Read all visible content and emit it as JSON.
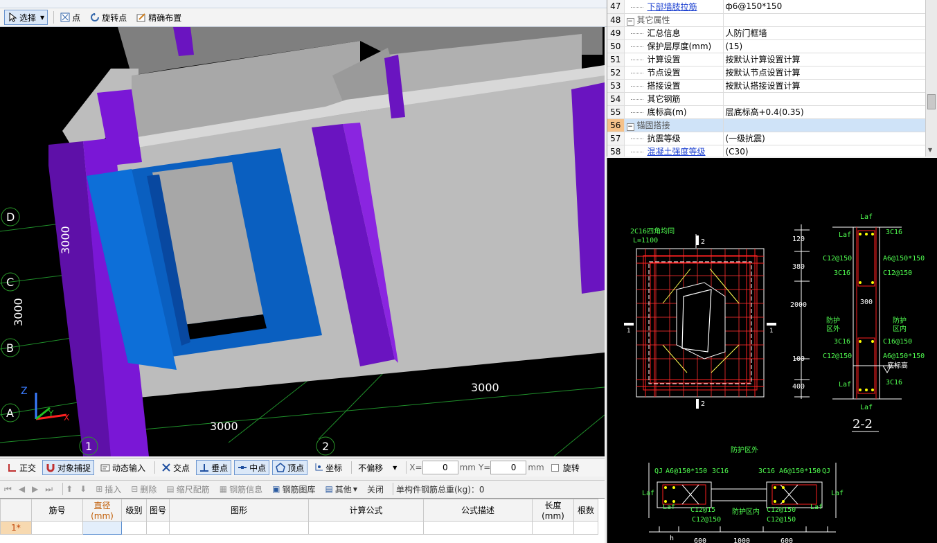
{
  "toolbar": {
    "select_label": "选择",
    "point_label": "点",
    "rotate_point_label": "旋转点",
    "precise_layout_label": "精确布置"
  },
  "viewport": {
    "axis_labels_rows": [
      "D",
      "C",
      "B",
      "A"
    ],
    "axis_labels_cols": [
      "1",
      "2"
    ],
    "dim_3000_a": "3000",
    "dim_3000_b": "3000",
    "dim_3000_c": "3000",
    "dim_3000_d": "3000",
    "axis_z": "Z",
    "axis_y": "Y",
    "axis_x": "X"
  },
  "snapbar": {
    "ortho": "正交",
    "object_snap": "对象捕捉",
    "dynamic_input": "动态输入",
    "intersection": "交点",
    "perpendicular": "垂点",
    "midpoint": "中点",
    "vertex": "顶点",
    "coordinate": "坐标",
    "offset_mode": "不偏移",
    "x_label": "X=",
    "x_value": "0",
    "y_label": "Y=",
    "y_value": "0",
    "unit_mm_1": "mm",
    "unit_mm_2": "mm",
    "rotate_label": "旋转"
  },
  "rebarbar": {
    "insert": "插入",
    "delete": "删除",
    "scale_rebar": "缩尺配筋",
    "rebar_info": "钢筋信息",
    "rebar_library": "钢筋图库",
    "other": "其他",
    "close": "关闭",
    "total_weight": "单构件钢筋总重(kg)：0"
  },
  "grid": {
    "headers": [
      "筋号",
      "直径(mm)",
      "级别",
      "图号",
      "图形",
      "计算公式",
      "公式描述",
      "长度(mm)",
      "根数"
    ],
    "row1_index": "1*"
  },
  "props": {
    "rows": [
      {
        "n": "47",
        "name": "下部墙肢拉筋",
        "value": "ф6@150*150",
        "link": true
      },
      {
        "n": "48",
        "name": "其它属性",
        "value": "",
        "group": true
      },
      {
        "n": "49",
        "name": "汇总信息",
        "value": "人防门框墙"
      },
      {
        "n": "50",
        "name": "保护层厚度(mm)",
        "value": "(15)"
      },
      {
        "n": "51",
        "name": "计算设置",
        "value": "按默认计算设置计算"
      },
      {
        "n": "52",
        "name": "节点设置",
        "value": "按默认节点设置计算"
      },
      {
        "n": "53",
        "name": "搭接设置",
        "value": "按默认搭接设置计算"
      },
      {
        "n": "54",
        "name": "其它钢筋",
        "value": ""
      },
      {
        "n": "55",
        "name": "底标高(m)",
        "value": "层底标高+0.4(0.35)"
      },
      {
        "n": "56",
        "name": "锚固搭接",
        "value": "",
        "group": true,
        "selected": true
      },
      {
        "n": "57",
        "name": "抗震等级",
        "value": "(一级抗震)"
      },
      {
        "n": "58",
        "name": "混凝土强度等级",
        "value": "(C30)",
        "link": true
      }
    ]
  },
  "drawing": {
    "note1": "2C16四角均同",
    "note2": "L=1100",
    "sec_mark_2": "2",
    "sec_mark_2b": "2",
    "sec_mark_1": "1",
    "sec_mark_1b": "1",
    "dims_v": [
      "120",
      "380",
      "2000",
      "100",
      "400"
    ],
    "laf_top": "Laf",
    "laf_left": "Laf",
    "c3c16_top": "3C16",
    "c12_150_a": "C12@150",
    "a6_a": "A6@150*150",
    "c3c16_a": "3C16",
    "c12_150_b": "C12@150",
    "d300": "300",
    "protect_out": "防护\n区外",
    "protect_in": "防护\n区内",
    "c3c16_b": "3C16",
    "c16_150": "C16@150",
    "c12_150_c": "C12@150",
    "a6_b": "A6@150*150",
    "floor_elev": "底标高",
    "laf_bottom": "Laf",
    "c3c16_c": "3C16",
    "laf_bottom2": "Laf",
    "section_title": "2-2",
    "plan_title": "防护区外",
    "plan_qj1": "QJ",
    "plan_a6_1": "A6@150*150",
    "plan_3c16_1": "3C16",
    "plan_3c16_2": "3C16",
    "plan_a6_2": "A6@150*150",
    "plan_qj2": "QJ",
    "plan_laf1": "Laf",
    "plan_laf2": "Laf",
    "plan_laf3": "Laf",
    "plan_laf4": "Laf",
    "plan_c12_1": "C12@15",
    "plan_inner": "防护区内",
    "plan_c12_2": "C12@150",
    "plan_c12_3": "C12@150",
    "plan_c12_4": "C12@150",
    "plan_dims": [
      "600",
      "1000",
      "600"
    ],
    "plan_h": "h"
  }
}
